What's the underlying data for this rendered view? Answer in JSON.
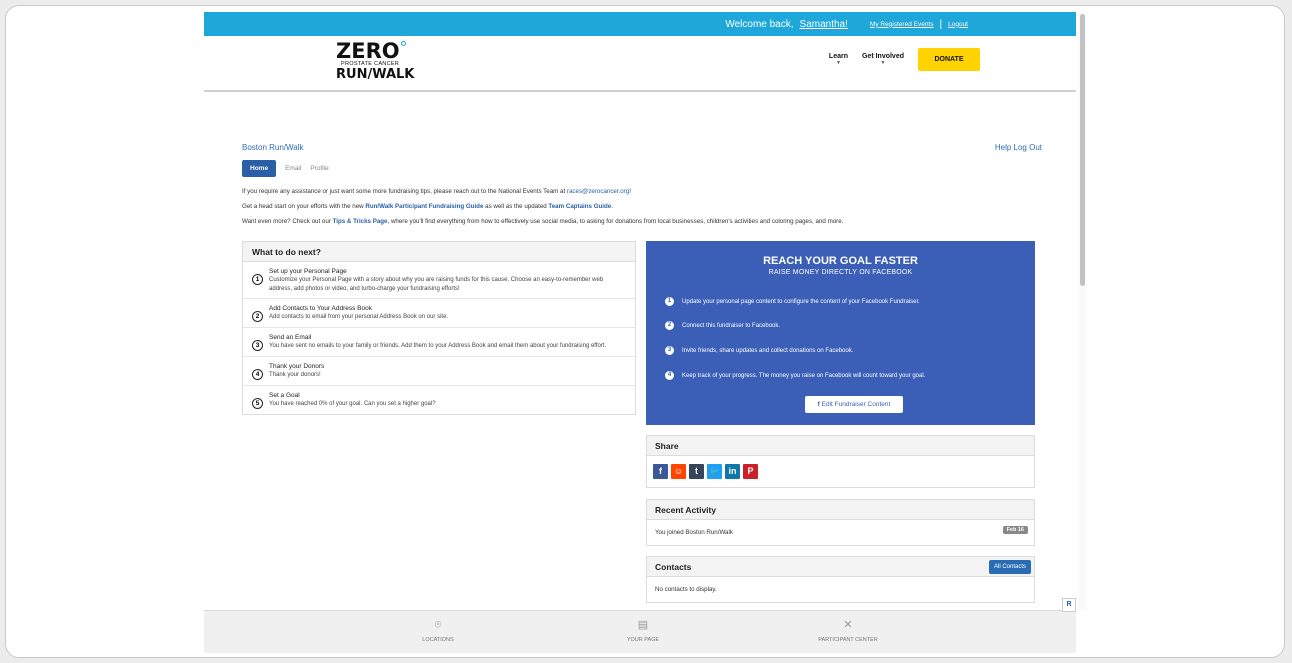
{
  "topbar": {
    "welcome": "Welcome back,",
    "user": "Samantha!",
    "registered_events": "My Registered Events",
    "separator": "|",
    "logout": "Logout",
    "bg": "#1ea7d8"
  },
  "logo": {
    "zero": "ZERO",
    "prostate": "PROSTATE CANCER",
    "runwalk": "RUN/WALK"
  },
  "nav": {
    "learn": "Learn",
    "get_involved": "Get Involved",
    "donate": "DONATE",
    "caret_icon": "chevron-down-icon",
    "donate_color": "#ffd200"
  },
  "breadcrumb": {
    "event": "Boston Run/Walk",
    "help": "Help",
    "logout": "Log Out"
  },
  "tabs": {
    "home": "Home",
    "email": "Email",
    "profile": "Profile"
  },
  "intro": {
    "p1_text": "If you require any assistance or just want some more fundraising tips, please reach out to the National Events Team at ",
    "p1_link": "races@zerocancer.org",
    "p1_end": "!",
    "p2_a": "Get a head start on your efforts with the new ",
    "p2_link1": "Run/Walk Participant Fundraising Guide",
    "p2_b": " as well as the updated ",
    "p2_link2": "Team Captains Guide",
    "p2_end": ".",
    "p3_a": "Want even more? Check out our ",
    "p3_link": "Tips & Tricks Page",
    "p3_b": ", where you'll find everything from how to effectively use social media, to asking for donations from local businesses, children's activities and coloring pages, and more."
  },
  "todo": {
    "heading": "What to do next?",
    "steps": [
      {
        "num": "1",
        "title": "Set up your Personal Page",
        "desc": "Customize your Personal Page with a story about why you are raising funds for this cause. Choose an easy-to-remember web address, add photos or video, and turbo-charge your fundraising efforts!"
      },
      {
        "num": "2",
        "title": "Add Contacts to Your Address Book",
        "desc": "Add contacts to email from your personal Address Book on our site."
      },
      {
        "num": "3",
        "title": "Send an Email",
        "desc": "You have sent no emails to your family or friends. Add them to your Address Book and email them about your fundraising effort."
      },
      {
        "num": "4",
        "title": "Thank your Donors",
        "desc": "Thank your donors!"
      },
      {
        "num": "5",
        "title": "Set a Goal",
        "desc": "You have reached 0% of your goal. Can you set a higher goal?"
      }
    ]
  },
  "facebook": {
    "title": "REACH YOUR GOAL FASTER",
    "subtitle": "RAISE MONEY DIRECTLY ON FACEBOOK",
    "items": [
      {
        "num": "1",
        "text": "Update your personal page content to configure the content of your Facebook Fundraiser."
      },
      {
        "num": "2",
        "text": "Connect this fundraiser to Facebook."
      },
      {
        "num": "3",
        "text": "Invite friends, share updates and collect donations on Facebook."
      },
      {
        "num": "4",
        "text": "Keep track of your progress. The money you raise on Facebook will count toward your goal."
      }
    ],
    "button": "Edit Fundraiser Content",
    "bg": "#3b5fb6"
  },
  "share": {
    "heading": "Share",
    "icons": [
      {
        "name": "facebook-icon",
        "glyph": "f",
        "color": "#3b5998"
      },
      {
        "name": "reddit-icon",
        "glyph": "☺",
        "color": "#ff4500"
      },
      {
        "name": "tumblr-icon",
        "glyph": "t",
        "color": "#35465c"
      },
      {
        "name": "twitter-icon",
        "glyph": "🐦",
        "color": "#1da1f2"
      },
      {
        "name": "linkedin-icon",
        "glyph": "in",
        "color": "#0e76a8"
      },
      {
        "name": "pinterest-icon",
        "glyph": "P",
        "color": "#cb2027"
      }
    ]
  },
  "activity": {
    "heading": "Recent Activity",
    "item": "You joined Boston Run/Walk",
    "date": "Feb 16"
  },
  "contacts": {
    "heading": "Contacts",
    "button": "All Contacts",
    "empty": "No contacts to display."
  },
  "footer": {
    "locations": "LOCATIONS",
    "your_page": "YOUR PAGE",
    "participant_center": "PARTICIPANT CENTER",
    "locations_icon": "map-pin-icon",
    "your_page_icon": "page-icon",
    "participant_icon": "tools-icon"
  }
}
